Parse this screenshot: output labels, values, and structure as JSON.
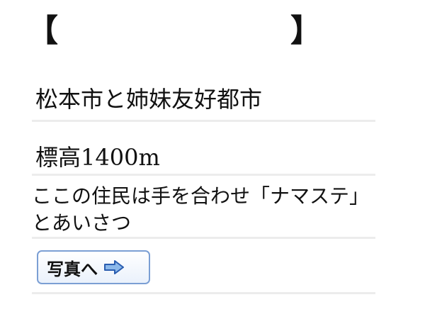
{
  "header": {
    "bracket_left": "【",
    "bracket_right": "】",
    "title": ""
  },
  "lines": {
    "sister_city": "松本市と姉妹友好都市",
    "altitude": "標高1400m",
    "greeting": "ここの住民は手を合わせ「ナマステ」とあいさつ"
  },
  "photo_button": {
    "label": "写真へ",
    "icon": "right-arrow-icon"
  },
  "colors": {
    "divider": "#ececec",
    "button_border": "#7b9fd4",
    "arrow_fill": "#8bb8ea",
    "arrow_stroke": "#2a5db0"
  }
}
